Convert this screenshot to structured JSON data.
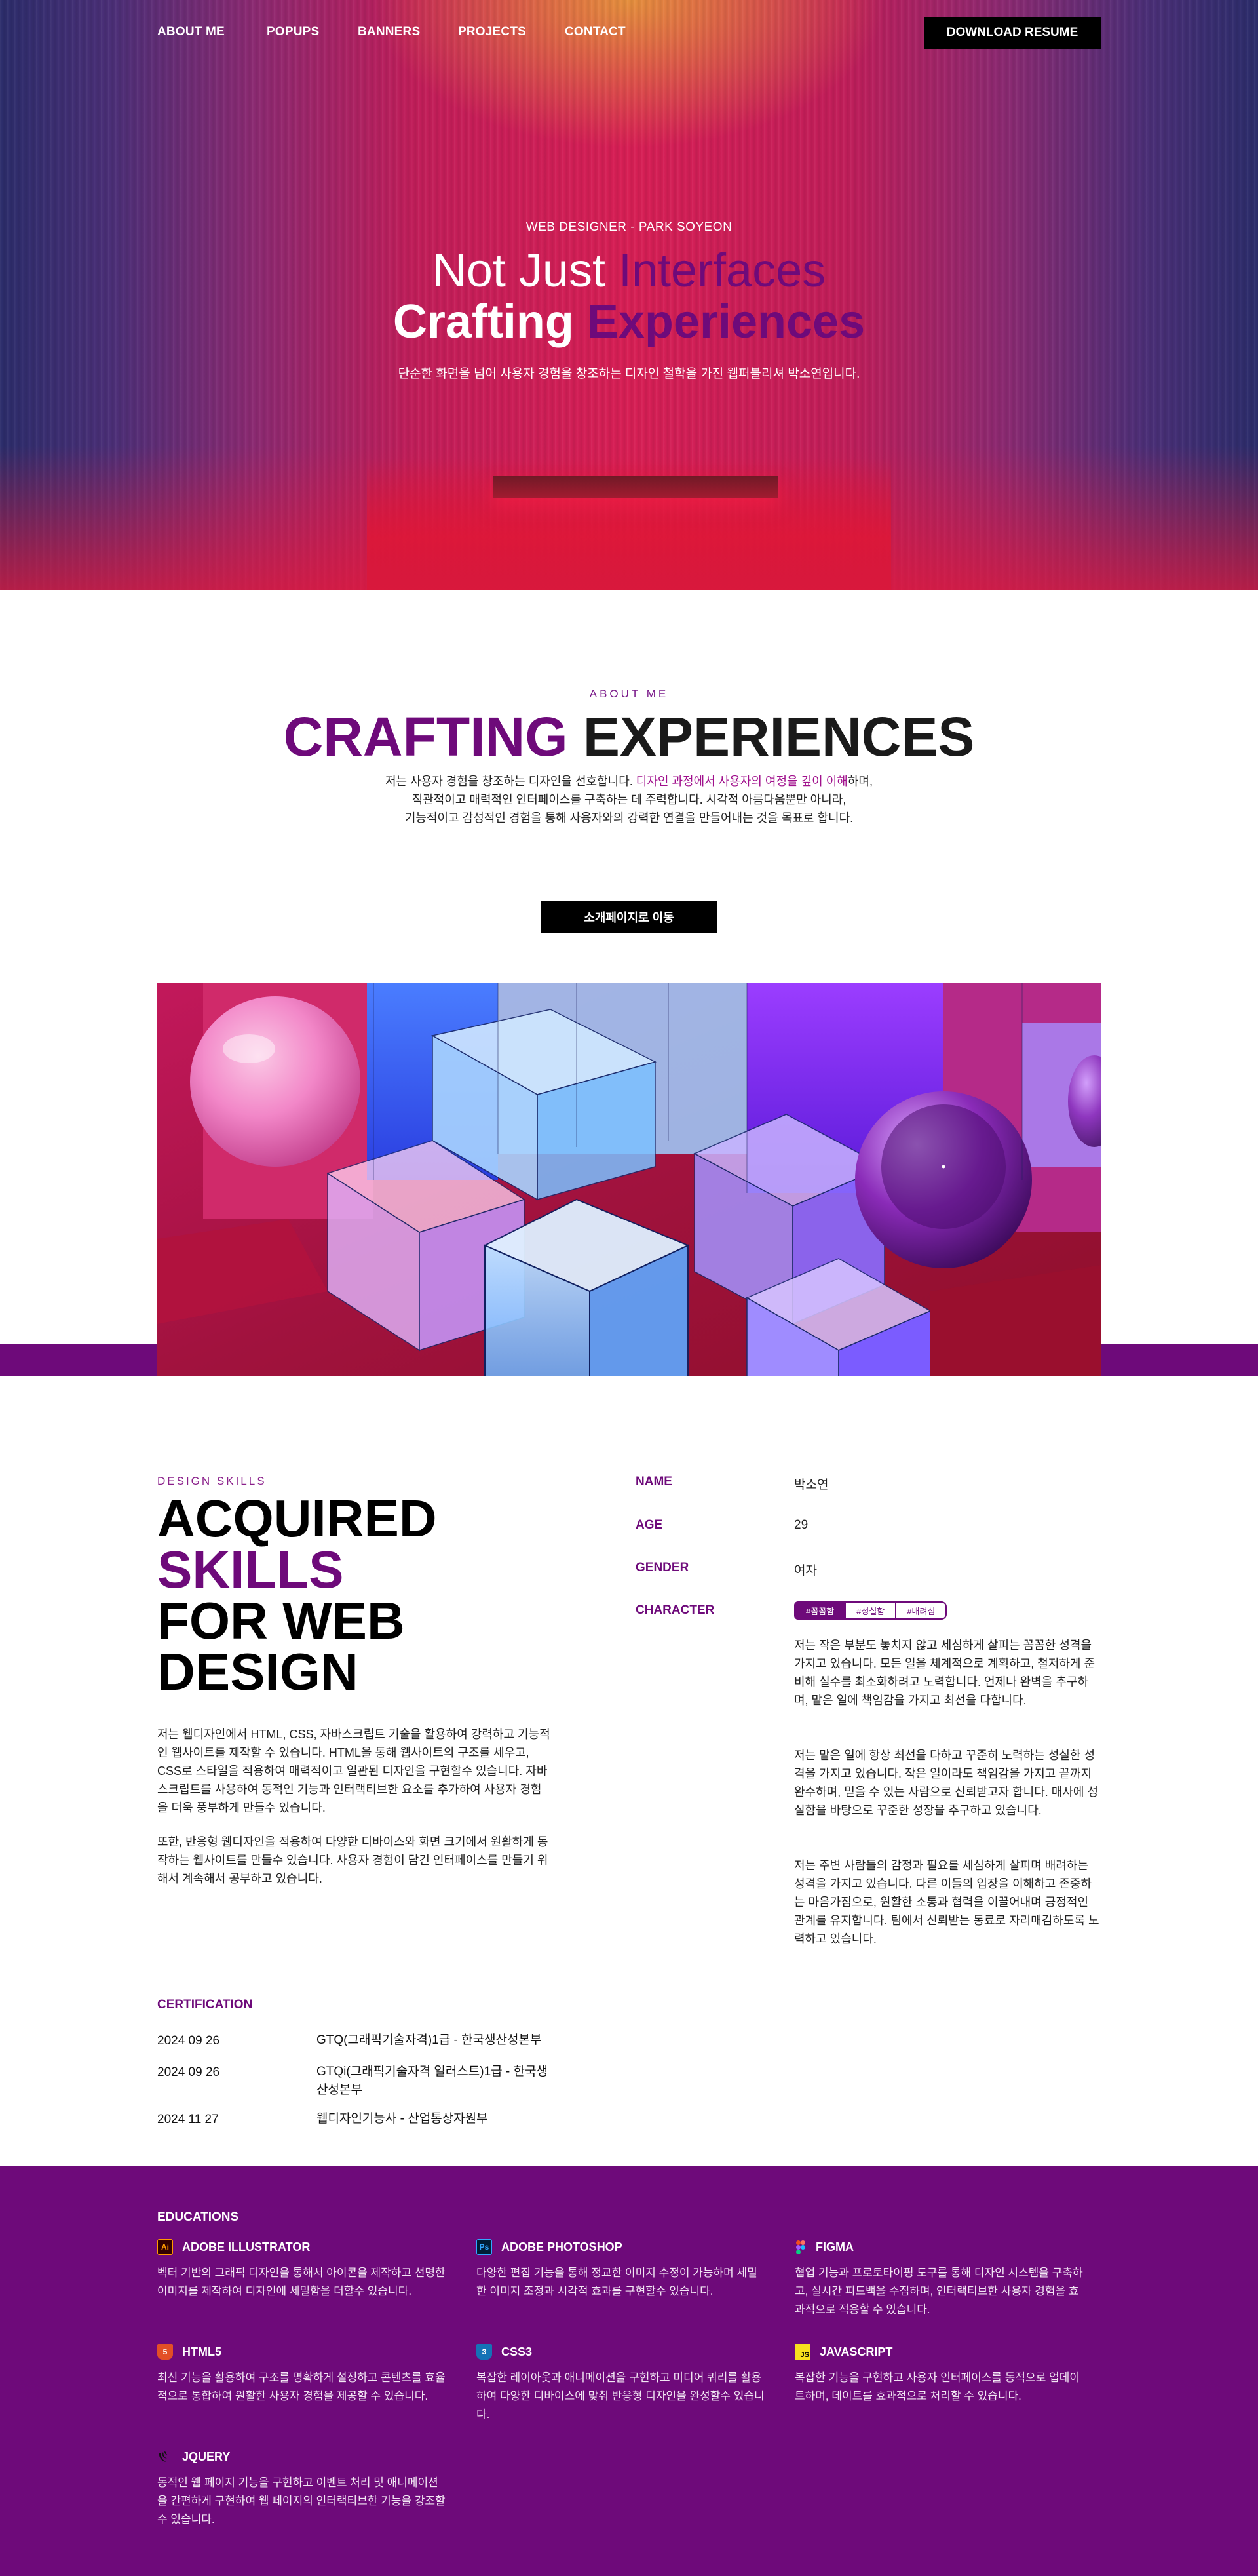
{
  "nav": {
    "links": [
      "ABOUT ME",
      "POPUPS",
      "BANNERS",
      "PROJECTS",
      "CONTACT"
    ],
    "resume_button": "DOWNLOAD RESUME"
  },
  "hero": {
    "eyebrow": "WEB DESIGNER - PARK SOYEON",
    "line1_a": "Not Just ",
    "line1_b": "Interfaces",
    "line2_a": "Crafting ",
    "line2_b": "Experiences",
    "description": "단순한 화면을 넘어 사용자 경험을 창조하는 디자인 철학을 가진 웹퍼블리셔 박소연입니다."
  },
  "about": {
    "eyebrow": "ABOUT ME",
    "title_a": "CRAFTING",
    "title_b": " EXPERIENCES",
    "body_1a": "저는 사용자 경험을 창조하는 디자인을 선호합니다. ",
    "body_1b": "디자인 과정에서 사용자의 여정을 깊이 이해",
    "body_1c": "하며,",
    "body_2": "직관적이고 매력적인 인터페이스를 구축하는 데 주력합니다. 시각적 아름다움뿐만 아니라,",
    "body_3": "기능적이고 감성적인 경험을 통해 사용자와의 강력한 연결을 만들어내는 것을 목표로 합니다.",
    "intro_button": "소개페이지로 이동"
  },
  "skills": {
    "eyebrow": "DESIGN SKILLS",
    "title_l1": "ACQUIRED",
    "title_l2": "SKILLS",
    "title_l3": "FOR WEB",
    "title_l4": "DESIGN",
    "p1": "저는 웹디자인에서 HTML, CSS, 자바스크립트 기술을 활용하여 강력하고 기능적인 웹사이트를 제작할 수 있습니다. HTML을 통해 웹사이트의 구조를 세우고, CSS로 스타일을 적용하여 매력적이고 일관된 디자인을 구현할수 있습니다. 자바스크립트를 사용하여 동적인 기능과 인터랙티브한 요소를 추가하여 사용자 경험을 더욱 풍부하게 만들수 있습니다.",
    "p2": "또한, 반응형 웹디자인을 적용하여 다양한 디바이스와 화면 크기에서 원활하게 동작하는 웹사이트를 만들수 있습니다. 사용자 경험이 담긴 인터페이스를 만들기 위해서 계속해서 공부하고 있습니다."
  },
  "profile": {
    "name_label": "NAME",
    "name_value": "박소연",
    "age_label": "AGE",
    "age_value": "29",
    "gender_label": "GENDER",
    "gender_value": "여자",
    "character_label": "CHARACTER",
    "tags": [
      "#꼼꼼함",
      "#성실함",
      "#배려심"
    ],
    "character_p1": "저는 작은 부분도 놓치지 않고 세심하게 살피는 꼼꼼한 성격을 가지고 있습니다. 모든 일을 체계적으로 계획하고, 철저하게 준비해 실수를 최소화하려고 노력합니다. 언제나 완벽을 추구하며, 맡은 일에 책임감을 가지고 최선을 다합니다.",
    "character_p2": "저는 맡은 일에 항상 최선을 다하고 꾸준히 노력하는 성실한 성격을 가지고 있습니다. 작은 일이라도 책임감을 가지고 끝까지 완수하며, 믿을 수 있는 사람으로 신뢰받고자 합니다. 매사에 성실함을 바탕으로 꾸준한 성장을 추구하고 있습니다.",
    "character_p3": "저는 주변 사람들의 감정과 필요를 세심하게 살피며 배려하는 성격을 가지고 있습니다.  다른 이들의 입장을 이해하고 존중하는 마음가짐으로, 원활한 소통과 협력을 이끌어내며 긍정적인 관계를 유지합니다. 팀에서 신뢰받는 동료로 자리매김하도록 노력하고 있습니다."
  },
  "certification": {
    "title": "CERTIFICATION",
    "items": [
      {
        "date": "2024 09 26",
        "name": "GTQ(그래픽기술자격)1급 - 한국생산성본부"
      },
      {
        "date": "2024 09 26",
        "name": "GTQi(그래픽기술자격 일러스트)1급 - 한국생산성본부"
      },
      {
        "date": "2024 11 27",
        "name": "웹디자인기능사 - 산업통상자원부"
      }
    ]
  },
  "educations": {
    "title": "EDUCATIONS",
    "items": [
      {
        "icon": "Ai",
        "name": "ADOBE ILLUSTRATOR",
        "desc": "벡터 기반의 그래픽 디자인을 통해서 아이콘을 제작하고 선명한 이미지를 제작하여 디자인에 세밀함을 더할수 있습니다."
      },
      {
        "icon": "Ps",
        "name": "ADOBE PHOTOSHOP",
        "desc": "다양한 편집 기능을 통해 정교한 이미지 수정이 가능하며 세밀한 이미지 조정과 시각적 효과를 구현할수 있습니다."
      },
      {
        "icon": "",
        "name": "FIGMA",
        "desc": "협업 기능과 프로토타이핑 도구를 통해 디자인 시스템을 구축하고, 실시간 피드백을 수집하며, 인터랙티브한 사용자 경험을 효과적으로 적용할 수 있습니다."
      },
      {
        "icon": "5",
        "name": "HTML5",
        "desc": "최신 기능을 활용하여 구조를 명확하게 설정하고 콘텐츠를 효율적으로 통합하여 원활한 사용자 경험을 제공할 수 있습니다."
      },
      {
        "icon": "3",
        "name": "CSS3",
        "desc": "복잡한 레이아웃과 애니메이션을 구현하고 미디어 쿼리를 활용하여 다양한 디바이스에 맞춰 반응형 디자인을 완성할수 있습니다."
      },
      {
        "icon": "JS",
        "name": "JAVASCRIPT",
        "desc": "복잡한 기능을 구현하고 사용자 인터페이스를 동적으로 업데이트하며, 데이트를 효과적으로 처리할 수 있습니다."
      },
      {
        "icon": "",
        "name": "JQUERY",
        "desc": "동적인 웹 페이지 기능을 구현하고 이벤트 처리 및 애니메이션을 간편하게 구현하여 웹 페이지의 인터랙티브한 기능을 강조할수 있습니다."
      }
    ]
  },
  "colors": {
    "brand_purple": "#6e0a7a",
    "highlight_magenta": "#a0108c",
    "button_black": "#000000"
  }
}
